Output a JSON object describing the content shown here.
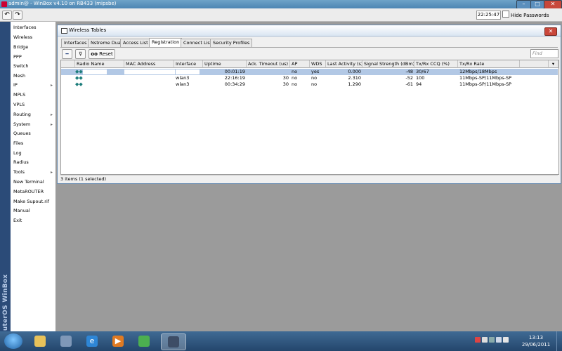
{
  "titlebar": {
    "title": "admin@                         - WinBox v4.10 on RB433 (mipsbe)",
    "minimize": "–",
    "maximize": "□",
    "close": "✕"
  },
  "toolbar": {
    "undo": "↶",
    "redo": "↷",
    "clock": "22:25:47",
    "hide_passwords": "Hide Passwords"
  },
  "side_brand": "RouterOS WinBox",
  "menu": {
    "items": [
      {
        "label": "Interfaces",
        "sub": ""
      },
      {
        "label": "Wireless",
        "sub": ""
      },
      {
        "label": "Bridge",
        "sub": ""
      },
      {
        "label": "PPP",
        "sub": ""
      },
      {
        "label": "Switch",
        "sub": ""
      },
      {
        "label": "Mesh",
        "sub": ""
      },
      {
        "label": "IP",
        "sub": "▸"
      },
      {
        "label": "MPLS",
        "sub": ""
      },
      {
        "label": "VPLS",
        "sub": ""
      },
      {
        "label": "Routing",
        "sub": "▸"
      },
      {
        "label": "System",
        "sub": "▸"
      },
      {
        "label": "Queues",
        "sub": ""
      },
      {
        "label": "Files",
        "sub": ""
      },
      {
        "label": "Log",
        "sub": ""
      },
      {
        "label": "Radius",
        "sub": ""
      },
      {
        "label": "Tools",
        "sub": "▸"
      },
      {
        "label": "New Terminal",
        "sub": ""
      },
      {
        "label": "MetaROUTER",
        "sub": ""
      },
      {
        "label": "Make Supout.rif",
        "sub": ""
      },
      {
        "label": "Manual",
        "sub": ""
      },
      {
        "label": "Exit",
        "sub": ""
      }
    ]
  },
  "window": {
    "title": "Wireless Tables",
    "close": "✕",
    "tabs": [
      "Interfaces",
      "Nstreme Dual",
      "Access List",
      "Registration",
      "Connect List",
      "Security Profiles"
    ],
    "active_tab": "Registration",
    "buttons": {
      "remove": "━",
      "filter": "⊽",
      "reset_icon": "oo",
      "reset": "Reset"
    },
    "find_placeholder": "Find",
    "columns": [
      "Radio Name",
      "MAC Address",
      "Interface",
      "Uptime",
      "Ack. Timeout (us)",
      "AP",
      "WDS",
      "Last Activity (s)",
      "Signal Strength (dBm)",
      "Tx/Rx CCQ (%)",
      "Tx/Rx Rate"
    ],
    "rows": [
      {
        "radio": "",
        "mac": "",
        "iface": "",
        "uptime": "00:01:19",
        "ack": "",
        "ap": "no",
        "wds": "yes",
        "last": "0.000",
        "signal": "-48",
        "ccq": "30/67",
        "rate": "12Mbps/18Mbps",
        "selected": true
      },
      {
        "radio": "",
        "mac": "",
        "iface": "wlan3",
        "uptime": "22:16:19",
        "ack": "30",
        "ap": "no",
        "wds": "no",
        "last": "2.310",
        "signal": "-52",
        "ccq": "100",
        "rate": "11Mbps-SP/11Mbps-SP",
        "selected": false
      },
      {
        "radio": "",
        "mac": "",
        "iface": "wlan3",
        "uptime": "00:34:29",
        "ack": "30",
        "ap": "no",
        "wds": "no",
        "last": "1.290",
        "signal": "-61",
        "ccq": "94",
        "rate": "11Mbps-SP/11Mbps-SP",
        "selected": false
      }
    ],
    "status": "3 items (1 selected)"
  },
  "taskbar": {
    "apps": [
      "explorer-icon",
      "media-icon",
      "ie-icon",
      "player-icon",
      "network-icon",
      "winbox-icon"
    ],
    "time": "13:13",
    "date": "29/06/2011"
  },
  "colors": {
    "title_bar": "#4d86b3",
    "side_brand": "#2b4b78",
    "desktop": "#9b9b9b",
    "selected_row": "#b2c8e5",
    "taskbar": "#24466c"
  }
}
